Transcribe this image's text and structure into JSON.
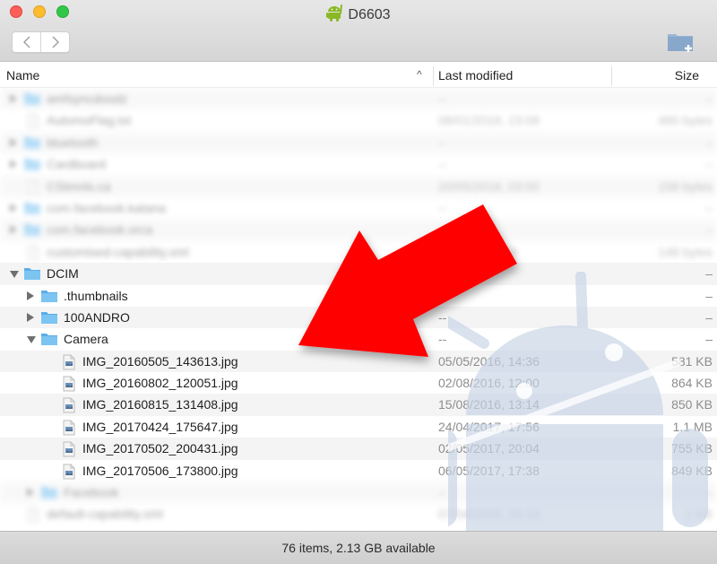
{
  "window": {
    "title": "D6603",
    "title_icon": "android-icon",
    "toolbar": {
      "back_icon": "chevron-left-icon",
      "forward_icon": "chevron-right-icon",
      "new_folder_icon": "new-folder-icon"
    }
  },
  "columns": {
    "name": "Name",
    "modified": "Last modified",
    "size": "Size",
    "sort_indicator": "^"
  },
  "rows": [
    {
      "name": "amfsyncdoodz",
      "modified": "--",
      "size": "–",
      "type": "folder",
      "level": 0,
      "state": "closed",
      "blurred": true
    },
    {
      "name": "AutomoFlag.txt",
      "modified": "08/01/2018, 13:08",
      "size": "480 bytes",
      "type": "file",
      "level": 0,
      "state": "none",
      "blurred": true
    },
    {
      "name": "bluetooth",
      "modified": "--",
      "size": "–",
      "type": "folder",
      "level": 0,
      "state": "closed",
      "blurred": true
    },
    {
      "name": "Cardboard",
      "modified": "--",
      "size": "–",
      "type": "folder",
      "level": 0,
      "state": "closed",
      "blurred": true
    },
    {
      "name": "CStmnls.ca",
      "modified": "20/05/2018, 03:50",
      "size": "158 bytes",
      "type": "file",
      "level": 0,
      "state": "none",
      "blurred": true
    },
    {
      "name": "com.facebook.katana",
      "modified": "--",
      "size": "–",
      "type": "folder",
      "level": 0,
      "state": "closed",
      "blurred": true
    },
    {
      "name": "com.facebook.orca",
      "modified": "--",
      "size": "–",
      "type": "folder",
      "level": 0,
      "state": "closed",
      "blurred": true
    },
    {
      "name": "customised-capability.xml",
      "modified": "--/--/----, 16:18",
      "size": "148 bytes",
      "type": "file",
      "level": 0,
      "state": "none",
      "blurred": true
    },
    {
      "name": "DCIM",
      "modified": "",
      "size": "–",
      "type": "folder",
      "level": 0,
      "state": "open",
      "blurred": false
    },
    {
      "name": ".thumbnails",
      "modified": "",
      "size": "–",
      "type": "folder",
      "level": 1,
      "state": "closed",
      "blurred": false
    },
    {
      "name": "100ANDRO",
      "modified": "--",
      "size": "–",
      "type": "folder",
      "level": 1,
      "state": "closed",
      "blurred": false
    },
    {
      "name": "Camera",
      "modified": "--",
      "size": "–",
      "type": "folder",
      "level": 1,
      "state": "open",
      "blurred": false
    },
    {
      "name": "IMG_20160505_143613.jpg",
      "modified": "05/05/2016, 14:36",
      "size": "581 KB",
      "type": "image",
      "level": 2,
      "state": "none",
      "blurred": false
    },
    {
      "name": "IMG_20160802_120051.jpg",
      "modified": "02/08/2016, 12:00",
      "size": "864 KB",
      "type": "image",
      "level": 2,
      "state": "none",
      "blurred": false
    },
    {
      "name": "IMG_20160815_131408.jpg",
      "modified": "15/08/2016, 13:14",
      "size": "850 KB",
      "type": "image",
      "level": 2,
      "state": "none",
      "blurred": false
    },
    {
      "name": "IMG_20170424_175647.jpg",
      "modified": "24/04/2017, 17:56",
      "size": "1.1 MB",
      "type": "image",
      "level": 2,
      "state": "none",
      "blurred": false
    },
    {
      "name": "IMG_20170502_200431.jpg",
      "modified": "02/05/2017, 20:04",
      "size": "755 KB",
      "type": "image",
      "level": 2,
      "state": "none",
      "blurred": false
    },
    {
      "name": "IMG_20170506_173800.jpg",
      "modified": "06/05/2017, 17:38",
      "size": "849 KB",
      "type": "image",
      "level": 2,
      "state": "none",
      "blurred": false
    },
    {
      "name": "Facebook",
      "modified": "--",
      "size": "–",
      "type": "folder",
      "level": 1,
      "state": "closed",
      "blurred": true
    },
    {
      "name": "default-capability.xml",
      "modified": "07/04/2020, 16:19",
      "size": "1 KB",
      "type": "file",
      "level": 0,
      "state": "none",
      "blurred": true
    }
  ],
  "status": {
    "text": "76 items, 2.13 GB available"
  },
  "annotation": {
    "type": "arrow",
    "color": "#ff0000",
    "points_to": "Camera"
  },
  "colors": {
    "folder": "#7cc4f2",
    "folder_dark": "#5aaee6",
    "accent_arrow": "#ff0000"
  }
}
